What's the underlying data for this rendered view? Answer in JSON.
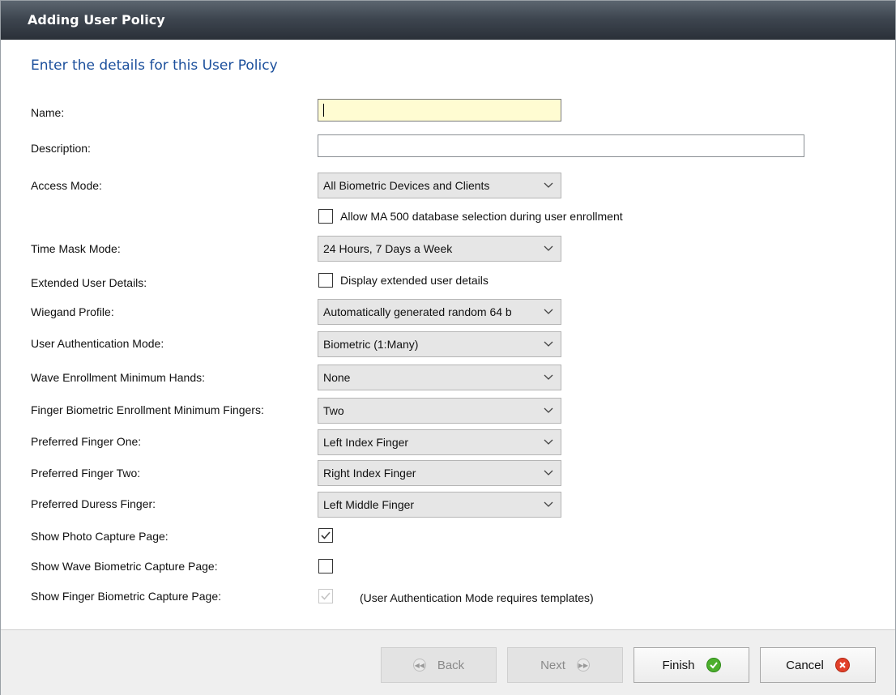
{
  "dialog": {
    "title": "Adding User Policy",
    "subtitle": "Enter the details for this User Policy"
  },
  "fields": {
    "name": {
      "label": "Name:",
      "value": ""
    },
    "description": {
      "label": "Description:",
      "value": ""
    },
    "access_mode": {
      "label": "Access Mode:",
      "value": "All Biometric Devices and Clients"
    },
    "ma500": {
      "label": "Allow MA 500 database selection during user enrollment",
      "checked": false
    },
    "time_mask_mode": {
      "label": "Time Mask Mode:",
      "value": "24 Hours, 7 Days a Week"
    },
    "extended_user_details": {
      "label": "Extended User Details:",
      "checkbox_label": "Display extended user details",
      "checked": false
    },
    "wiegand_profile": {
      "label": "Wiegand Profile:",
      "value": "Automatically generated random 64 b"
    },
    "user_auth_mode": {
      "label": "User Authentication Mode:",
      "value": "Biometric (1:Many)"
    },
    "wave_min_hands": {
      "label": "Wave Enrollment Minimum Hands:",
      "value": "None"
    },
    "finger_min_fingers": {
      "label": "Finger Biometric Enrollment Minimum Fingers:",
      "value": "Two"
    },
    "preferred_finger_one": {
      "label": "Preferred Finger One:",
      "value": "Left Index Finger"
    },
    "preferred_finger_two": {
      "label": "Preferred Finger Two:",
      "value": "Right Index Finger"
    },
    "preferred_duress_finger": {
      "label": "Preferred Duress Finger:",
      "value": "Left Middle Finger"
    },
    "show_photo_capture": {
      "label": "Show Photo Capture Page:",
      "checked": true
    },
    "show_wave_capture": {
      "label": "Show Wave Biometric Capture Page:",
      "checked": false
    },
    "show_finger_capture": {
      "label": "Show Finger Biometric Capture Page:",
      "checked": true,
      "note": "(User Authentication Mode requires templates)"
    }
  },
  "buttons": {
    "back": "Back",
    "next": "Next",
    "finish": "Finish",
    "cancel": "Cancel"
  },
  "icons": {
    "dropdown": "chevron-down-icon",
    "back": "rewind-icon",
    "next": "fast-forward-icon",
    "finish": "checkmark-circle-icon",
    "cancel": "close-circle-icon"
  },
  "colors": {
    "title_bar": "#3e4650",
    "subtitle": "#1b4f9c",
    "focused_input": "#fffcd2",
    "finish_icon": "#4caf2d",
    "cancel_icon": "#e2402a"
  }
}
